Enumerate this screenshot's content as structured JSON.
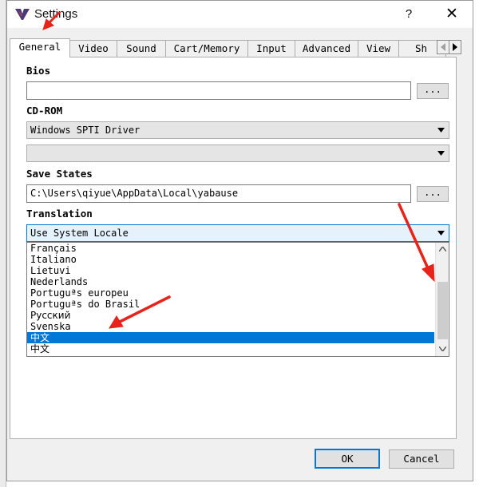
{
  "window": {
    "title": "Settings",
    "help_label": "?",
    "close_label": "✕"
  },
  "tabs": [
    {
      "label": "General",
      "active": true
    },
    {
      "label": "Video"
    },
    {
      "label": "Sound"
    },
    {
      "label": "Cart/Memory"
    },
    {
      "label": "Input"
    },
    {
      "label": "Advanced"
    },
    {
      "label": "View"
    },
    {
      "label": "Sh"
    }
  ],
  "bios": {
    "label": "Bios",
    "value": "",
    "browse_label": "..."
  },
  "cdrom": {
    "label": "CD-ROM",
    "driver_value": "Windows SPTI Driver",
    "drive_value": ""
  },
  "save_states": {
    "label": "Save States",
    "value": "C:\\Users\\qiyue\\AppData\\Local\\yabause",
    "browse_label": "..."
  },
  "translation": {
    "label": "Translation",
    "selected_value": "Use System Locale",
    "options": [
      "Français",
      "Italiano",
      "Lietuvi",
      "Nederlands",
      "Portuguªs europeu",
      "Portuguªs do Brasil",
      "Русский",
      "Svenska",
      "中文",
      "中文"
    ],
    "highlighted_index": 8
  },
  "footer": {
    "ok_label": "OK",
    "cancel_label": "Cancel"
  },
  "colors": {
    "accent": "#0078d7",
    "annotation": "#e8231a"
  },
  "icons": {
    "app": "yabause-logo-icon",
    "dropdown": "chevron-down-icon",
    "tab_scroll_right": "triangle-right-icon"
  }
}
